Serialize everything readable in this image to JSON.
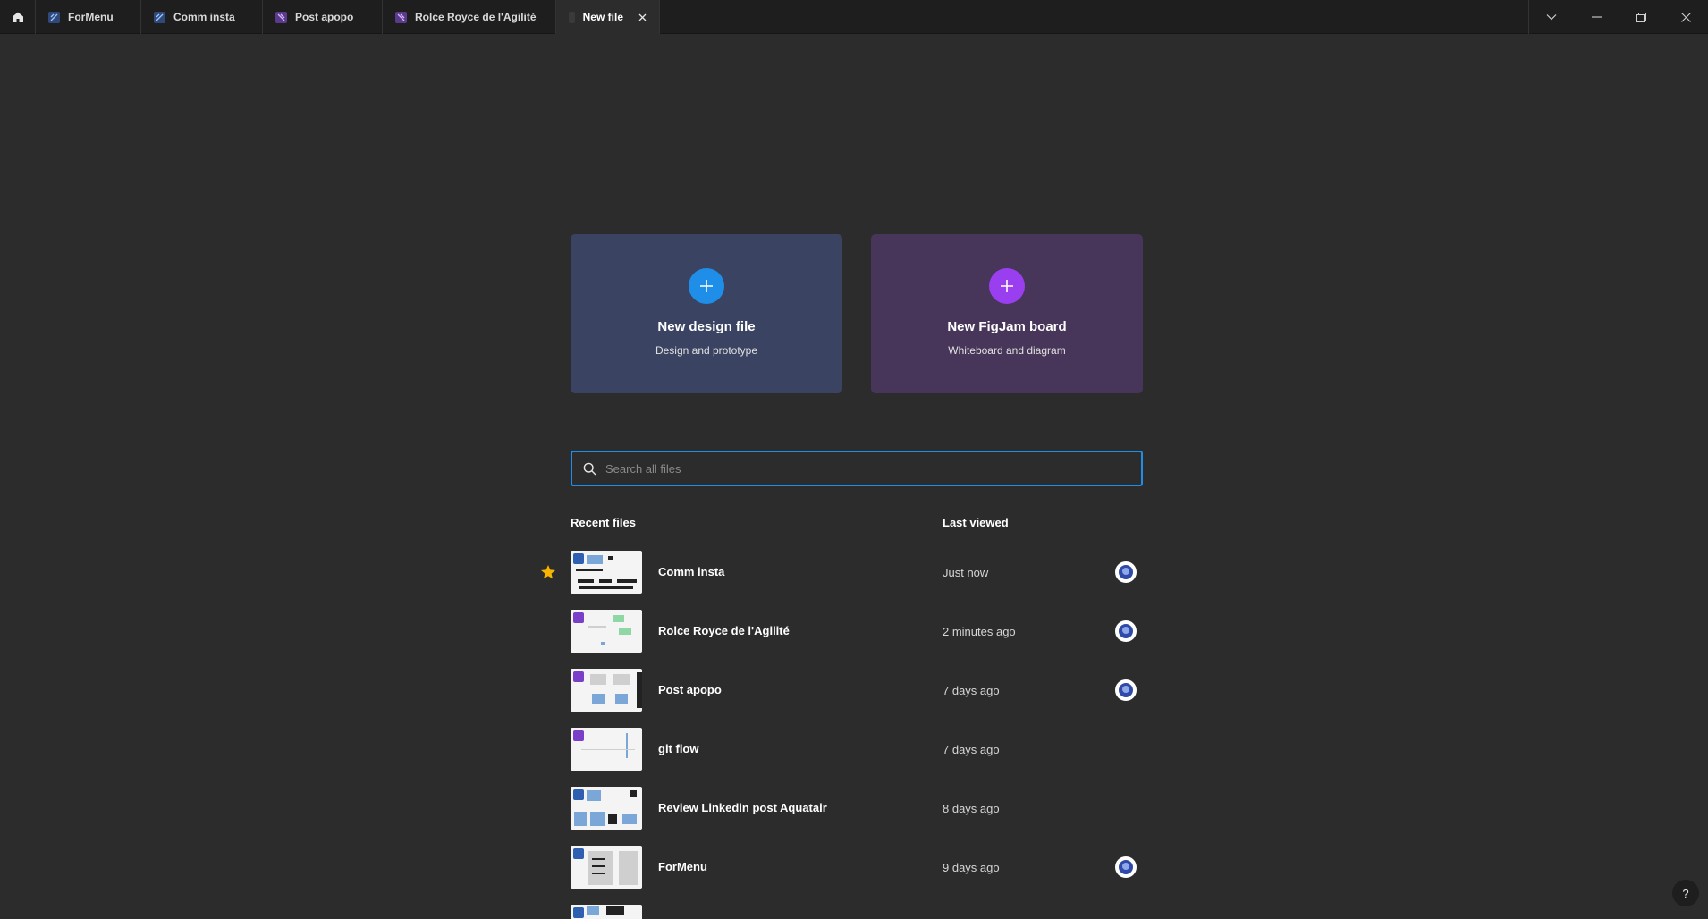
{
  "tabs": [
    {
      "label": "ForMenu",
      "kind": "design",
      "active": false
    },
    {
      "label": "Comm insta",
      "kind": "design",
      "active": false
    },
    {
      "label": "Post apopo",
      "kind": "figjam",
      "active": false
    },
    {
      "label": "Rolce Royce de l'Agilité",
      "kind": "figjam",
      "active": false
    },
    {
      "label": "New file",
      "kind": "blank",
      "active": true
    }
  ],
  "cards": {
    "design": {
      "title": "New design file",
      "subtitle": "Design and prototype"
    },
    "figjam": {
      "title": "New FigJam board",
      "subtitle": "Whiteboard and diagram"
    }
  },
  "search": {
    "placeholder": "Search all files",
    "value": ""
  },
  "list": {
    "header_recent": "Recent files",
    "header_last_viewed": "Last viewed",
    "files": [
      {
        "name": "Comm insta",
        "time": "Just now",
        "starred": true,
        "kind": "design",
        "avatar": true
      },
      {
        "name": "Rolce Royce de l'Agilité",
        "time": "2 minutes ago",
        "starred": false,
        "kind": "figjam",
        "avatar": true
      },
      {
        "name": "Post apopo",
        "time": "7 days ago",
        "starred": false,
        "kind": "figjam",
        "avatar": true
      },
      {
        "name": "git flow",
        "time": "7 days ago",
        "starred": false,
        "kind": "figjam",
        "avatar": false
      },
      {
        "name": "Review Linkedin post Aquatair",
        "time": "8 days ago",
        "starred": false,
        "kind": "design",
        "avatar": false
      },
      {
        "name": "ForMenu",
        "time": "9 days ago",
        "starred": false,
        "kind": "design",
        "avatar": true
      }
    ]
  },
  "help": {
    "label": "?"
  },
  "colors": {
    "accent_blue": "#1f8ee8",
    "accent_purple": "#9a3ff0",
    "star": "#f7b500"
  }
}
